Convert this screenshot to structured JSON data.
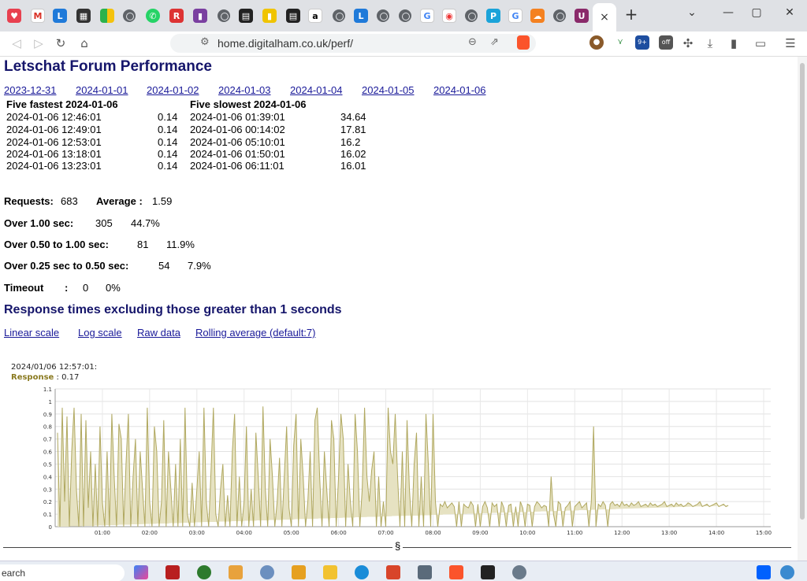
{
  "browser": {
    "url": "home.digitalham.co.uk/perf/",
    "new_tab_label": "+",
    "close_tab_label": "×",
    "window_controls": [
      "⌄",
      "—",
      "▢",
      "✕"
    ],
    "extension_badges": [
      "9+",
      "off"
    ]
  },
  "page": {
    "title": "Letschat Forum Performance",
    "date_links": [
      "2023-12-31",
      "2024-01-01",
      "2024-01-02",
      "2024-01-03",
      "2024-01-04",
      "2024-01-05",
      "2024-01-06"
    ],
    "fastest": {
      "header": "Five fastest 2024-01-06",
      "rows": [
        {
          "time": "2024-01-06 12:46:01",
          "value": "0.14"
        },
        {
          "time": "2024-01-06 12:49:01",
          "value": "0.14"
        },
        {
          "time": "2024-01-06 12:53:01",
          "value": "0.14"
        },
        {
          "time": "2024-01-06 13:18:01",
          "value": "0.14"
        },
        {
          "time": "2024-01-06 13:23:01",
          "value": "0.14"
        }
      ]
    },
    "slowest": {
      "header": "Five slowest 2024-01-06",
      "rows": [
        {
          "time": "2024-01-06 01:39:01",
          "value": "34.64"
        },
        {
          "time": "2024-01-06 00:14:02",
          "value": "17.81"
        },
        {
          "time": "2024-01-06 05:10:01",
          "value": "16.2"
        },
        {
          "time": "2024-01-06 01:50:01",
          "value": "16.02"
        },
        {
          "time": "2024-01-06 06:11:01",
          "value": "16.01"
        }
      ]
    },
    "stats": {
      "requests_label": "Requests:",
      "requests": "683",
      "average_label": "Average :",
      "average": "1.59",
      "over1_label": "Over 1.00 sec:",
      "over1_count": "305",
      "over1_pct": "44.7%",
      "over050_label": "Over 0.50 to 1.00 sec:",
      "over050_count": "81",
      "over050_pct": "11.9%",
      "over025_label": "Over 0.25 sec to 0.50 sec:",
      "over025_count": "54",
      "over025_pct": "7.9%",
      "timeout_label": "Timeout",
      "timeout_colon": ":",
      "timeout_count": "0",
      "timeout_pct": "0%"
    },
    "chart_heading": "Response times excluding those greater than 1 seconds",
    "scale_links": [
      "Linear scale",
      "Log scale",
      "Raw data",
      "Rolling average (default:7)"
    ],
    "tooltip": {
      "timestamp": "2024/01/06 12:57:01:",
      "label": "Response",
      "value": ": 0.17"
    },
    "footer_symbol": "§"
  },
  "taskbar": {
    "search_text": "earch"
  },
  "colors": {
    "heading": "#16166b",
    "link": "#1a1a99",
    "series": "#b0a860",
    "series_fill": "#e6e2c2"
  },
  "chart_data": {
    "type": "area",
    "title": "",
    "xlabel": "",
    "ylabel": "",
    "ylim": [
      0,
      1.1
    ],
    "yticks": [
      "0",
      "0.1",
      "0.2",
      "0.3",
      "0.4",
      "0.5",
      "0.6",
      "0.7",
      "0.8",
      "0.9",
      "1",
      "1.1"
    ],
    "xticks": [
      "01:00",
      "02:00",
      "03:00",
      "04:00",
      "05:00",
      "06:00",
      "07:00",
      "08:00",
      "09:00",
      "10:00",
      "11:00",
      "12:00",
      "13:00",
      "14:00",
      "15:00"
    ],
    "xlim_hours": [
      0,
      15.15
    ],
    "grid": true,
    "series": [
      {
        "name": "Response",
        "hours": [
          0.05,
          0.1,
          0.15,
          0.2,
          0.25,
          0.3,
          0.35,
          0.4,
          0.45,
          0.5,
          0.55,
          0.6,
          0.65,
          0.7,
          0.75,
          0.8,
          0.85,
          0.9,
          0.95,
          1.0,
          1.05,
          1.1,
          1.15,
          1.2,
          1.25,
          1.3,
          1.35,
          1.4,
          1.45,
          1.5,
          1.55,
          1.6,
          1.65,
          1.7,
          1.75,
          1.8,
          1.85,
          1.9,
          1.95,
          2.0,
          2.05,
          2.1,
          2.15,
          2.2,
          2.25,
          2.3,
          2.35,
          2.4,
          2.45,
          2.5,
          2.55,
          2.6,
          2.65,
          2.7,
          2.75,
          2.8,
          2.85,
          2.9,
          2.95,
          3.0,
          3.05,
          3.1,
          3.15,
          3.2,
          3.25,
          3.3,
          3.35,
          3.4,
          3.45,
          3.5,
          3.55,
          3.6,
          3.65,
          3.7,
          3.75,
          3.8,
          3.85,
          3.9,
          3.95,
          4.0,
          4.05,
          4.1,
          4.15,
          4.2,
          4.25,
          4.3,
          4.35,
          4.4,
          4.45,
          4.5,
          4.55,
          4.6,
          4.65,
          4.7,
          4.75,
          4.8,
          4.85,
          4.9,
          4.95,
          5.0,
          5.05,
          5.1,
          5.15,
          5.2,
          5.25,
          5.3,
          5.35,
          5.4,
          5.45,
          5.5,
          5.55,
          5.6,
          5.65,
          5.7,
          5.75,
          5.8,
          5.85,
          5.9,
          5.95,
          6.0,
          6.05,
          6.1,
          6.15,
          6.2,
          6.25,
          6.3,
          6.35,
          6.4,
          6.45,
          6.5,
          6.55,
          6.6,
          6.65,
          6.7,
          6.75,
          6.8,
          6.85,
          6.9,
          6.95,
          7.0,
          7.05,
          7.1,
          7.15,
          7.2,
          7.25,
          7.3,
          7.35,
          7.4,
          7.45,
          7.5,
          7.55,
          7.6,
          7.65,
          7.7,
          7.75,
          7.8,
          7.85,
          7.9,
          7.95,
          8.0,
          8.05,
          8.1,
          8.15,
          8.2,
          8.25,
          8.3,
          8.35,
          8.4,
          8.45,
          8.5,
          8.55,
          8.6,
          8.65,
          8.7,
          8.75,
          8.8,
          8.85,
          8.9,
          8.95,
          9.0,
          9.05,
          9.1,
          9.15,
          9.2,
          9.25,
          9.3,
          9.35,
          9.4,
          9.45,
          9.5,
          9.55,
          9.6,
          9.65,
          9.7,
          9.75,
          9.8,
          9.85,
          9.9,
          9.95,
          10.0,
          10.05,
          10.1,
          10.15,
          10.2,
          10.25,
          10.3,
          10.35,
          10.4,
          10.45,
          10.5,
          10.55,
          10.6,
          10.65,
          10.7,
          10.75,
          10.8,
          10.85,
          10.9,
          10.95,
          11.0,
          11.05,
          11.1,
          11.15,
          11.2,
          11.25,
          11.3,
          11.35,
          11.4,
          11.45,
          11.5,
          11.55,
          11.6,
          11.65,
          11.7,
          11.75,
          11.8,
          11.85,
          11.9,
          11.95,
          12.0,
          12.05,
          12.1,
          12.15,
          12.2,
          12.25,
          12.3,
          12.35,
          12.4,
          12.45,
          12.5,
          12.55,
          12.6,
          12.65,
          12.7,
          12.75,
          12.8,
          12.85,
          12.9,
          12.95,
          13.0,
          13.05,
          13.1,
          13.15,
          13.2,
          13.25,
          13.3,
          13.35,
          13.4,
          13.45,
          13.5,
          13.55,
          13.6,
          13.65,
          13.7,
          13.75,
          13.8,
          13.85,
          13.9,
          13.95,
          14.0,
          14.05,
          14.1,
          14.15,
          14.2,
          14.25,
          14.3,
          14.35,
          14.4,
          14.45,
          14.5,
          14.55,
          14.6,
          14.65,
          14.7,
          14.75,
          14.8,
          14.85,
          14.9,
          14.95,
          15.0,
          15.05,
          15.1
        ],
        "values": [
          0.75,
          0,
          0.95,
          0.2,
          0.88,
          0,
          0.6,
          0.95,
          0.3,
          0,
          0.9,
          0,
          0.85,
          0.15,
          0.6,
          0,
          0.5,
          0,
          0.8,
          0.2,
          0,
          0.6,
          0,
          0.9,
          0.4,
          0,
          0.82,
          0.7,
          0,
          0.5,
          0.9,
          0,
          0.4,
          0.7,
          0,
          0.6,
          0.3,
          0,
          0.95,
          0.2,
          0,
          0.8,
          0.6,
          0,
          0.2,
          0.85,
          0,
          0.6,
          0.3,
          0,
          0.5,
          0,
          0.7,
          0,
          0.95,
          0.1,
          0,
          0.35,
          0,
          0.3,
          0.6,
          0,
          0.95,
          0.2,
          0,
          0.45,
          0.95,
          0.1,
          0,
          0.3,
          0.5,
          0,
          0.25,
          0,
          0.6,
          0.9,
          0,
          0.4,
          0,
          0.2,
          0.8,
          0,
          0.3,
          0,
          0.75,
          0.4,
          0,
          0.96,
          0.3,
          0,
          0.7,
          0.4,
          0,
          0.2,
          0.55,
          0,
          0.4,
          0.8,
          0.15,
          0,
          0.65,
          0.9,
          0,
          0.7,
          0.4,
          0,
          0.2,
          0.6,
          0,
          0.85,
          0.95,
          0.4,
          0,
          0.6,
          0.3,
          0,
          0.85,
          0.7,
          0,
          0.4,
          0.9,
          0.7,
          0,
          0.5,
          0.2,
          0,
          0.9,
          0.6,
          0,
          0.3,
          0.95,
          0.4,
          0.2,
          0.45,
          0.6,
          0,
          0.4,
          0,
          0.2,
          0,
          0.95,
          0.6,
          0.5,
          0.9,
          0.4,
          0,
          0.6,
          0,
          0.85,
          0.3,
          0,
          0.5,
          0.75,
          0,
          0.4,
          0,
          0.9,
          0.5,
          0,
          0.9,
          0.2,
          0,
          0.18,
          0.16,
          0.2,
          0.15,
          0.17,
          0.19,
          0.16,
          0,
          0.2,
          0,
          0.18,
          0.16,
          0.15,
          0.2,
          0.17,
          0,
          0.18,
          0,
          0.16,
          0.2,
          0.15,
          0,
          0.19,
          0.16,
          0.18,
          0,
          0.2,
          0.15,
          0,
          0.17,
          0.18,
          0,
          0.16,
          0,
          0.2,
          0.15,
          0,
          0.18,
          0.17,
          0,
          0.16,
          0.2,
          0.18,
          0.15,
          0.17,
          0.16,
          0,
          0.4,
          0.1,
          0,
          0.2,
          0.18,
          0,
          0.15,
          0.17,
          0.2,
          0,
          0.16,
          0.18,
          0.2,
          0.15,
          0.17,
          0.19,
          0,
          0.2,
          0.8,
          0,
          0.18,
          0.16,
          0.2,
          0.17,
          0,
          0.18,
          0.2,
          0.17,
          0.18,
          0.16,
          0.2,
          0.17,
          0.18,
          0.16,
          0.19,
          0.17,
          0.18,
          0.2,
          0.16,
          0.17,
          0.18,
          0.16,
          0.19,
          0.17,
          0.18,
          0.16,
          0.17,
          0.18,
          0.2,
          0.16,
          0.17,
          0.18,
          0.16,
          0.19,
          0.17,
          0.18,
          0.16,
          0.17,
          0.19,
          0.18,
          0.16,
          0.17,
          0.18,
          0.2,
          0.16,
          0.17,
          0.18,
          0.16,
          0.17,
          0.18,
          0.19,
          0.16,
          0.17,
          0.18,
          0.16,
          0.17
        ]
      }
    ]
  }
}
